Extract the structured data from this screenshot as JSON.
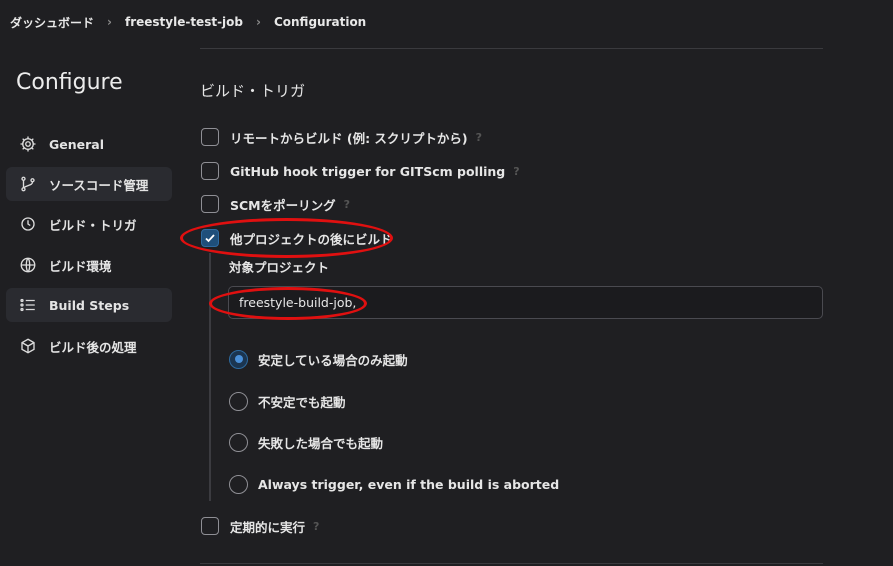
{
  "breadcrumb": [
    "ダッシュボード",
    "freestyle-test-job",
    "Configuration"
  ],
  "sidebar": {
    "title": "Configure",
    "items": [
      {
        "label": "General",
        "icon": "gear-icon",
        "active": false
      },
      {
        "label": "ソースコード管理",
        "icon": "git-branch-icon",
        "active": true
      },
      {
        "label": "ビルド・トリガ",
        "icon": "clock-icon",
        "active": false
      },
      {
        "label": "ビルド環境",
        "icon": "globe-icon",
        "active": false
      },
      {
        "label": "Build Steps",
        "icon": "list-icon",
        "active": true
      },
      {
        "label": "ビルド後の処理",
        "icon": "cube-icon",
        "active": false
      }
    ]
  },
  "build_triggers": {
    "title": "ビルド・トリガ",
    "options": [
      {
        "label": "リモートからビルド (例: スクリプトから)",
        "checked": false
      },
      {
        "label": "GitHub hook trigger for GITScm polling",
        "checked": false
      },
      {
        "label": "SCMをポーリング",
        "checked": false
      },
      {
        "label": "他プロジェクトの後にビルド",
        "checked": true
      },
      {
        "label": "定期的に実行",
        "checked": false
      }
    ],
    "target_project_label": "対象プロジェクト",
    "target_project_value": "freestyle-build-job,",
    "radio_options": [
      {
        "label": "安定している場合のみ起動",
        "checked": true
      },
      {
        "label": "不安定でも起動",
        "checked": false
      },
      {
        "label": "失敗した場合でも起動",
        "checked": false
      },
      {
        "label": "Always trigger, even if the build is aborted",
        "checked": false
      }
    ]
  },
  "colors": {
    "annotation": "#e01010",
    "accent": "#2d6aa0",
    "background": "#1f1f22"
  }
}
